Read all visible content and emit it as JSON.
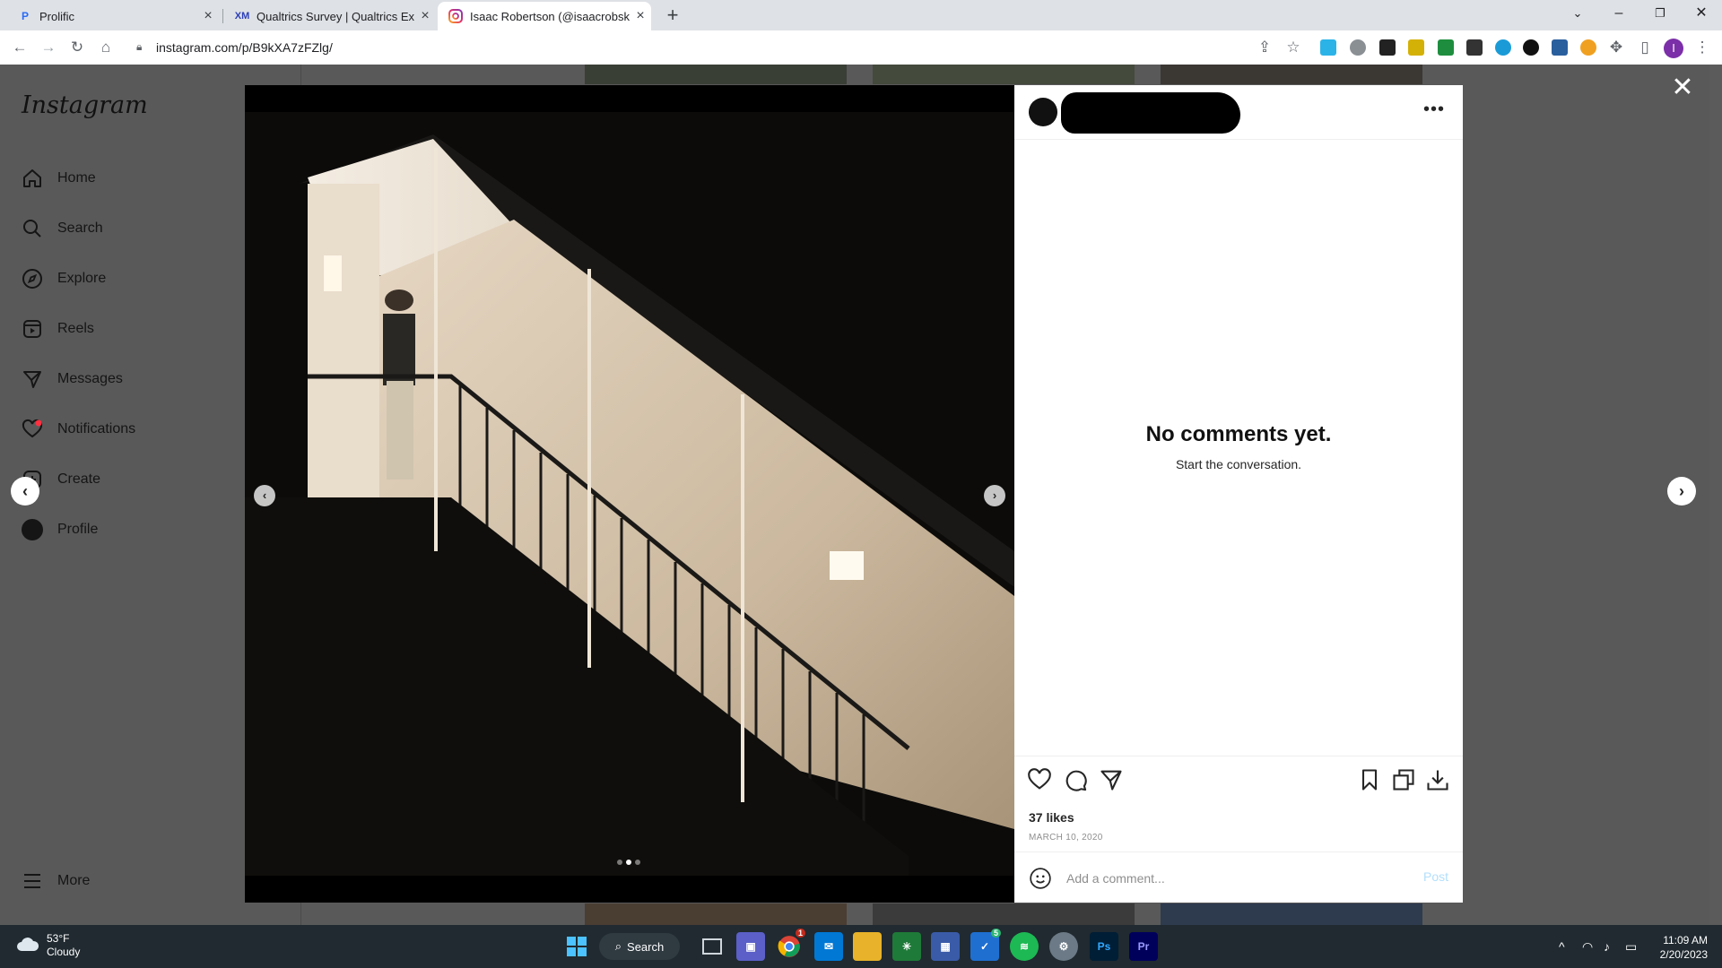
{
  "browser": {
    "tabs": [
      {
        "title": "Prolific",
        "favicon": "prolific-icon"
      },
      {
        "title": "Qualtrics Survey | Qualtrics Exper",
        "favicon": "qualtrics-icon"
      },
      {
        "title": "Isaac Robertson (@isaacrobskrrt",
        "favicon": "instagram-icon"
      }
    ],
    "url": "instagram.com/p/B9kXA7zFZlg/"
  },
  "instagram": {
    "logo": "Instagram",
    "nav": [
      {
        "label": "Home",
        "icon": "home-icon"
      },
      {
        "label": "Search",
        "icon": "search-icon"
      },
      {
        "label": "Explore",
        "icon": "compass-icon"
      },
      {
        "label": "Reels",
        "icon": "reels-icon"
      },
      {
        "label": "Messages",
        "icon": "send-icon"
      },
      {
        "label": "Notifications",
        "icon": "heart-icon"
      },
      {
        "label": "Create",
        "icon": "plus-square-icon"
      },
      {
        "label": "Profile",
        "icon": "profile-avatar-icon"
      }
    ],
    "more_label": "More"
  },
  "post": {
    "empty_title": "No comments yet.",
    "empty_subtitle": "Start the conversation.",
    "likes": "37 likes",
    "date": "MARCH 10, 2020",
    "comment_placeholder": "Add a comment...",
    "post_label": "Post",
    "carousel": {
      "count": 3,
      "active": 1
    }
  },
  "taskbar": {
    "weather_temp": "53°F",
    "weather_desc": "Cloudy",
    "search_label": "Search",
    "time": "11:09 AM",
    "date": "2/20/2023",
    "badges": {
      "chrome": "1",
      "todo": "5"
    }
  }
}
